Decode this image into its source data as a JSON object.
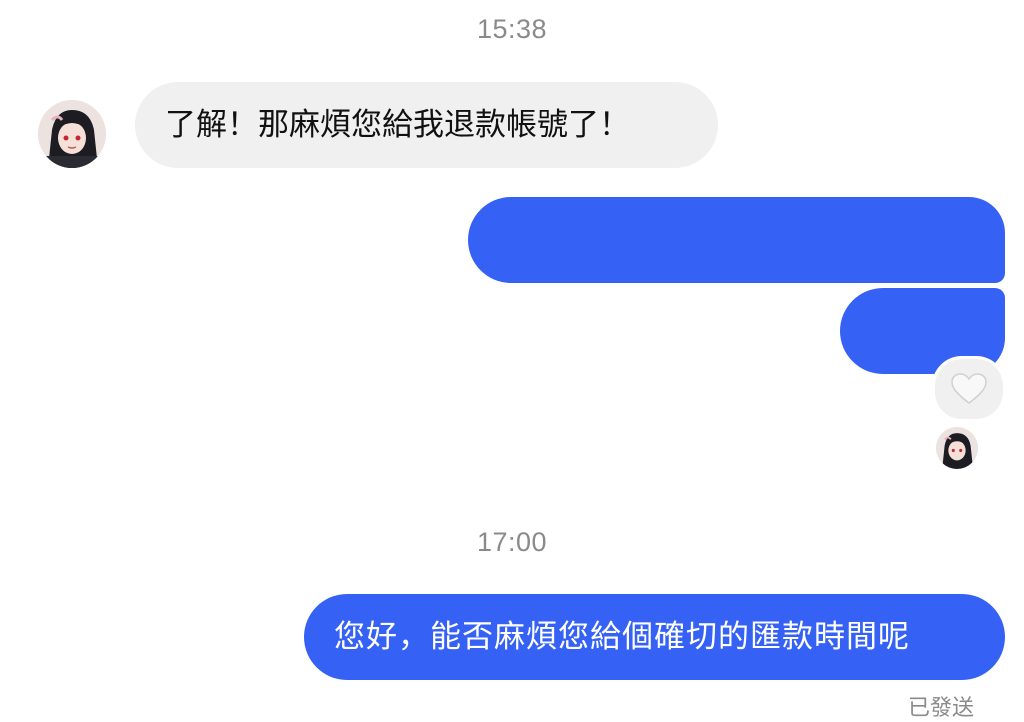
{
  "conversation": {
    "timestamps": [
      "15:38",
      "17:00"
    ],
    "messages": [
      {
        "direction": "incoming",
        "text": "了解！那麻煩您給我退款帳號了！"
      },
      {
        "direction": "outgoing",
        "text": ""
      },
      {
        "direction": "outgoing",
        "text": "",
        "reaction": "heart-icon"
      },
      {
        "direction": "outgoing",
        "text": "您好，能否麻煩您給個確切的匯款時間呢"
      }
    ],
    "status": "已發送"
  },
  "colors": {
    "outgoing_bubble": "#3561f5",
    "incoming_bubble": "#f0f0f0",
    "timestamp_text": "#8a8a8a"
  }
}
